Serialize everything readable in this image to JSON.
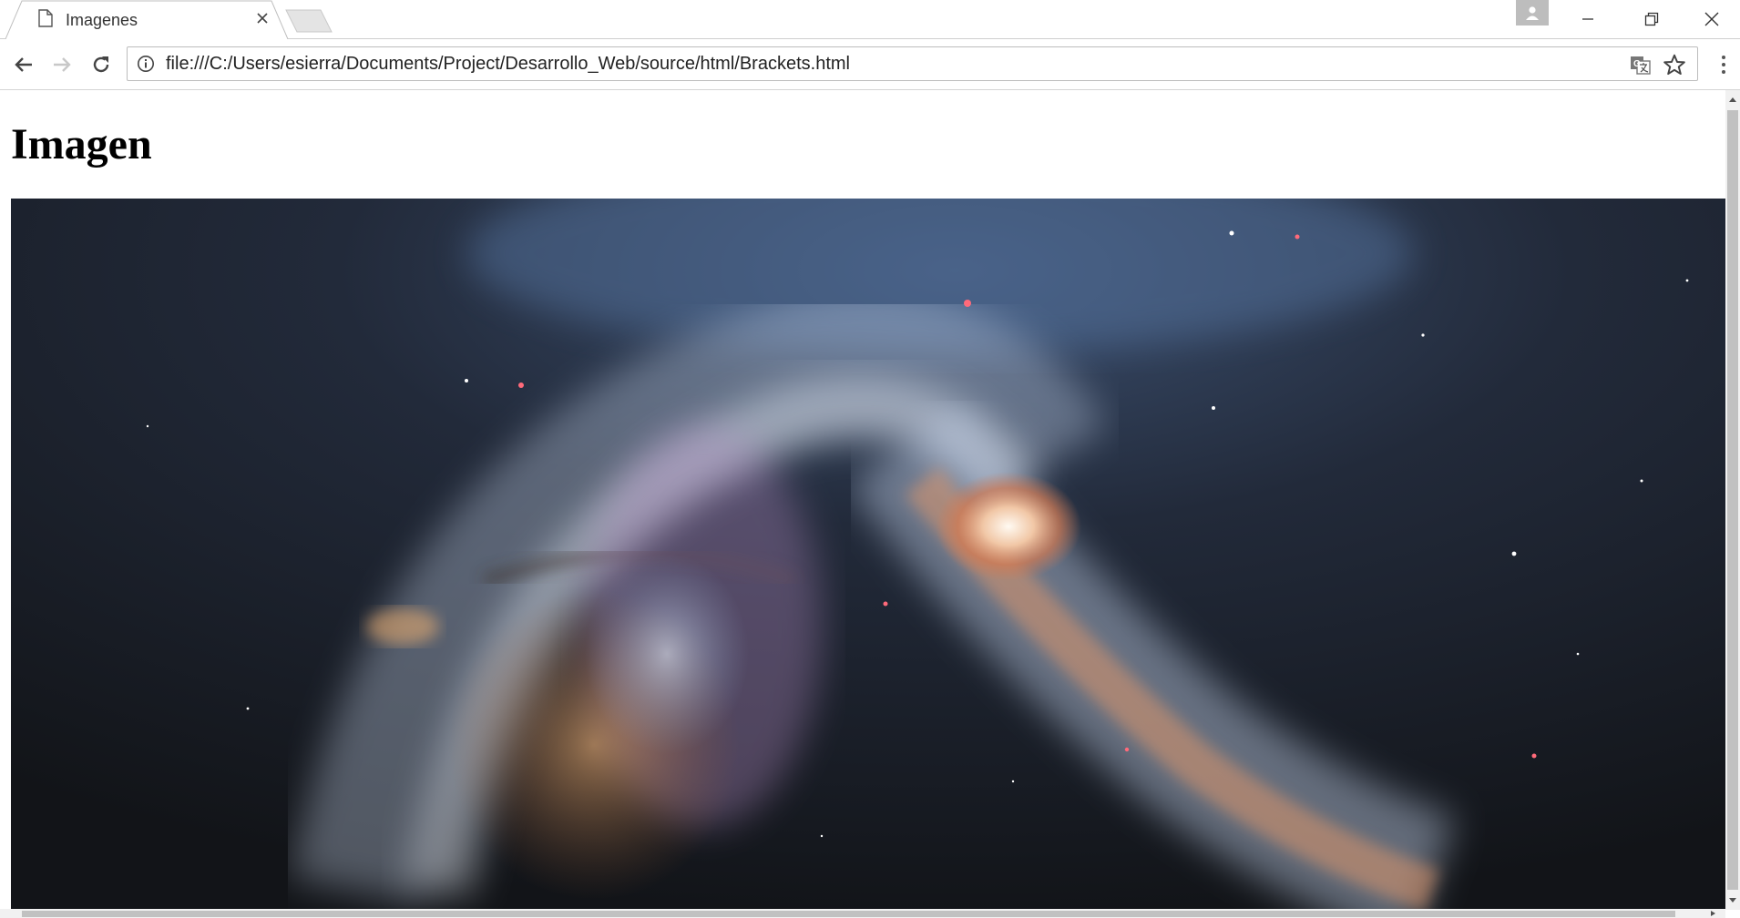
{
  "browser": {
    "tab": {
      "title": "Imagenes",
      "favicon": "page-icon"
    },
    "address_bar": {
      "url": "file:///C:/Users/esierra/Documents/Project/Desarrollo_Web/source/html/Brackets.html",
      "info_icon": "info-icon",
      "translate_icon": "translate-icon",
      "bookmark_icon": "star-icon"
    },
    "nav": {
      "back": "back-arrow-icon",
      "forward": "forward-arrow-icon",
      "reload": "reload-icon"
    },
    "window_controls": [
      "minimize-icon",
      "restore-icon",
      "close-icon"
    ]
  },
  "page": {
    "heading": "Imagen",
    "image": {
      "subject": "galaxy",
      "colors": {
        "space": "#1a1f2b",
        "core": "#f4e8e0",
        "arms": "#e2885c",
        "glow": "#b9c8e8"
      }
    }
  }
}
